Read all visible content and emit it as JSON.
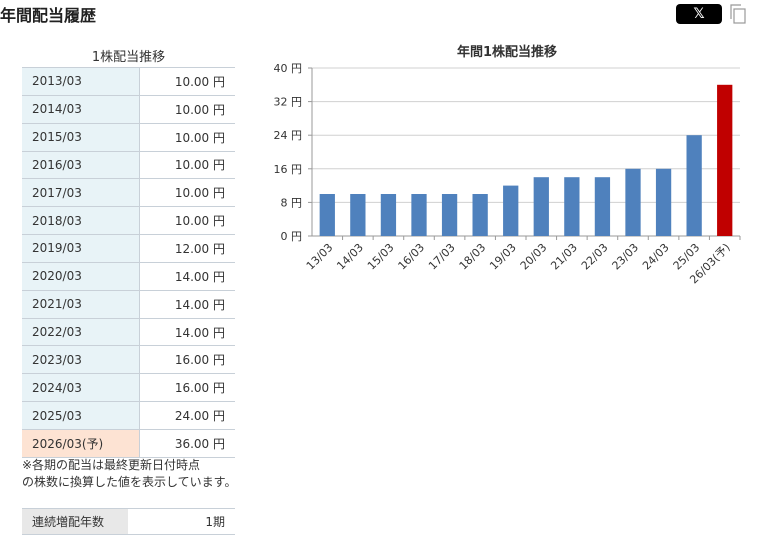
{
  "section_title": "年間配当履歴",
  "share_button": {
    "label": "𝕏"
  },
  "table_title": "1株配当推移",
  "dividend_rows": [
    {
      "period": "2013/03",
      "amount": "10.00 円",
      "forecast": false
    },
    {
      "period": "2014/03",
      "amount": "10.00 円",
      "forecast": false
    },
    {
      "period": "2015/03",
      "amount": "10.00 円",
      "forecast": false
    },
    {
      "period": "2016/03",
      "amount": "10.00 円",
      "forecast": false
    },
    {
      "period": "2017/03",
      "amount": "10.00 円",
      "forecast": false
    },
    {
      "period": "2018/03",
      "amount": "10.00 円",
      "forecast": false
    },
    {
      "period": "2019/03",
      "amount": "12.00 円",
      "forecast": false
    },
    {
      "period": "2020/03",
      "amount": "14.00 円",
      "forecast": false
    },
    {
      "period": "2021/03",
      "amount": "14.00 円",
      "forecast": false
    },
    {
      "period": "2022/03",
      "amount": "14.00 円",
      "forecast": false
    },
    {
      "period": "2023/03",
      "amount": "16.00 円",
      "forecast": false
    },
    {
      "period": "2024/03",
      "amount": "16.00 円",
      "forecast": false
    },
    {
      "period": "2025/03",
      "amount": "24.00 円",
      "forecast": false
    },
    {
      "period": "2026/03(予)",
      "amount": "36.00 円",
      "forecast": true
    }
  ],
  "note_line1": "※各期の配当は最終更新日付時点",
  "note_line2": "の株数に換算した値を表示しています。",
  "streak": {
    "label": "連続増配年数",
    "value": "1期"
  },
  "chart_data": {
    "type": "bar",
    "title": "年間1株配当推移",
    "categories": [
      "13/03",
      "14/03",
      "15/03",
      "16/03",
      "17/03",
      "18/03",
      "19/03",
      "20/03",
      "21/03",
      "22/03",
      "23/03",
      "24/03",
      "25/03",
      "26/03(予)"
    ],
    "values": [
      10,
      10,
      10,
      10,
      10,
      10,
      12,
      14,
      14,
      14,
      16,
      16,
      24,
      36
    ],
    "ylim": [
      0,
      40
    ],
    "yticks": [
      0,
      8,
      16,
      24,
      32,
      40
    ],
    "ytick_suffix": " 円",
    "grid": true,
    "colors": {
      "actual": "#4f81bd",
      "forecast": "#c00000"
    },
    "forecast_index": 13
  }
}
